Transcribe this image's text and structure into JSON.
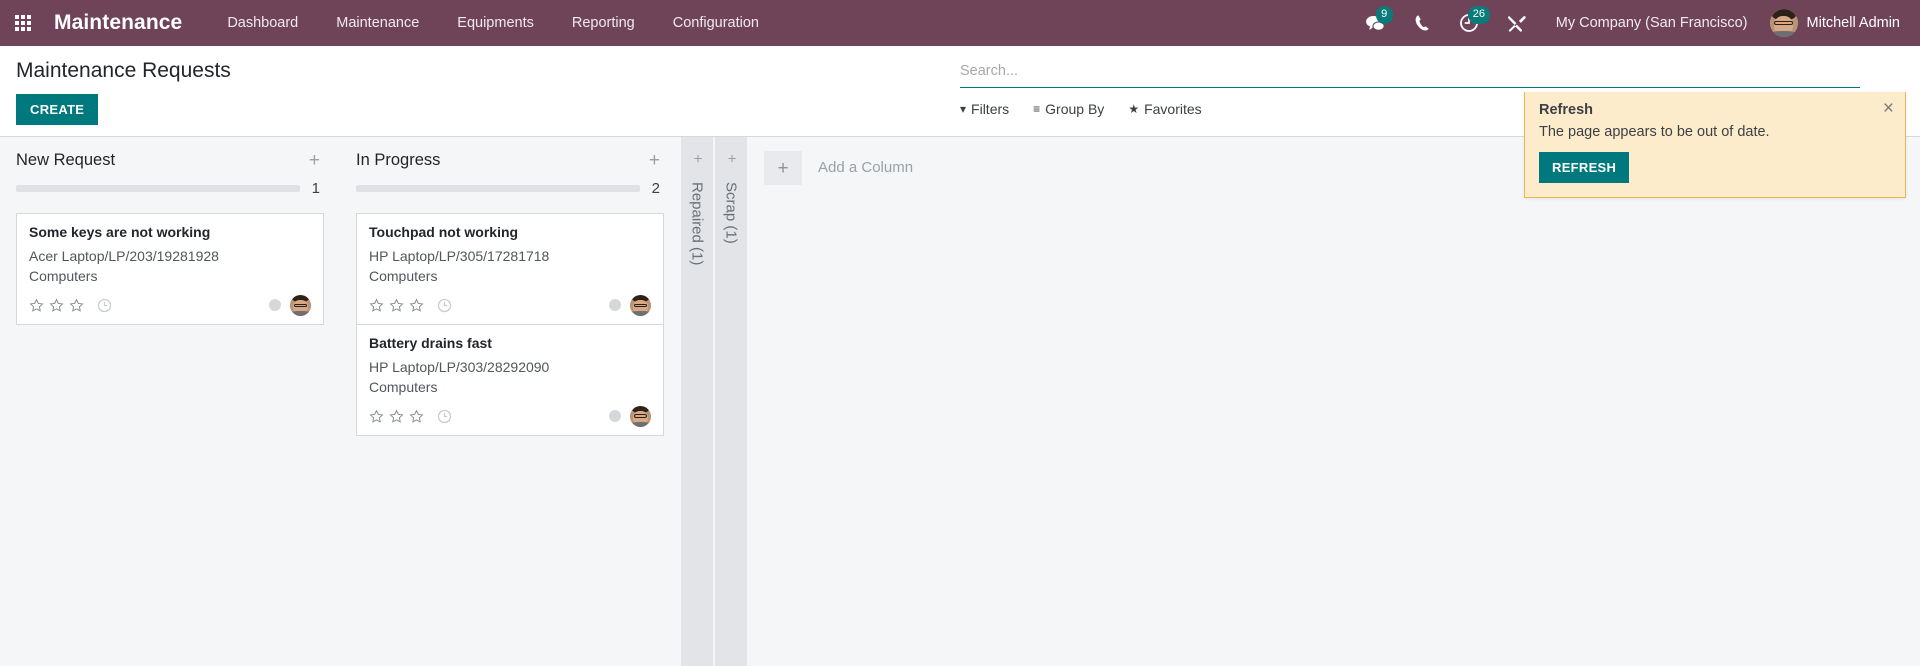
{
  "navbar": {
    "apps_icon": "apps-grid-icon",
    "brand": "Maintenance",
    "menu": [
      {
        "label": "Dashboard"
      },
      {
        "label": "Maintenance"
      },
      {
        "label": "Equipments"
      },
      {
        "label": "Reporting"
      },
      {
        "label": "Configuration"
      }
    ],
    "icons": [
      {
        "name": "messages-icon",
        "badge": "9"
      },
      {
        "name": "phone-icon",
        "badge": ""
      },
      {
        "name": "activity-clock-icon",
        "badge": "26"
      },
      {
        "name": "debug-tools-icon",
        "badge": ""
      }
    ],
    "company": "My Company (San Francisco)",
    "user": "Mitchell Admin"
  },
  "control_panel": {
    "title": "Maintenance Requests",
    "create_label": "CREATE",
    "search": {
      "value": "",
      "placeholder": "Search..."
    },
    "filters": [
      {
        "label": "Filters",
        "icon": "funnel-icon"
      },
      {
        "label": "Group By",
        "icon": "bars-icon"
      },
      {
        "label": "Favorites",
        "icon": "star-icon"
      }
    ]
  },
  "notification": {
    "title": "Refresh",
    "body": "The page appears to be out of date.",
    "button": "REFRESH",
    "close_icon": "close-icon"
  },
  "kanban": {
    "add_icon": "plus-icon",
    "columns": [
      {
        "title": "New Request",
        "count": "1",
        "cards": [
          {
            "title": "Some keys are not working",
            "equipment": "Acer Laptop/LP/203/19281928",
            "category": "Computers",
            "stars": 0,
            "clock_icon": "clock-icon",
            "state_icon": "kanban-state-grey",
            "avatar": "user-avatar"
          }
        ]
      },
      {
        "title": "In Progress",
        "count": "2",
        "cards": [
          {
            "title": "Touchpad not working",
            "equipment": "HP Laptop/LP/305/17281718",
            "category": "Computers",
            "stars": 0,
            "clock_icon": "clock-icon",
            "state_icon": "kanban-state-grey",
            "avatar": "user-avatar"
          },
          {
            "title": "Battery drains fast",
            "equipment": "HP Laptop/LP/303/28292090",
            "category": "Computers",
            "stars": 0,
            "clock_icon": "clock-icon",
            "state_icon": "kanban-state-grey",
            "avatar": "user-avatar"
          }
        ]
      }
    ],
    "folded_columns": [
      {
        "label": "Repaired (1)"
      },
      {
        "label": "Scrap (1)"
      }
    ],
    "add_column_label": "Add a Column"
  },
  "colors": {
    "navbar": "#6f4459",
    "accent": "#00797e",
    "badge": "#0a7b7b",
    "kanban_bg": "#f5f6f8",
    "folded_col": "#e2e4e7",
    "notification_bg": "#fdeccb",
    "notification_border": "#e8b951"
  }
}
